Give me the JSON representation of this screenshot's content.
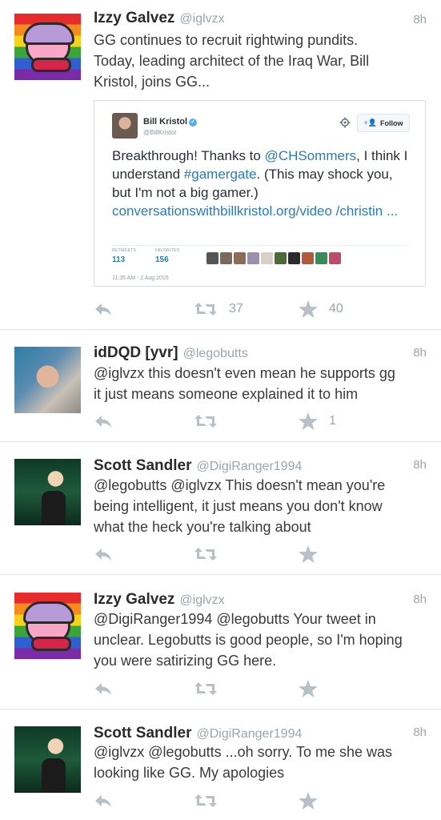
{
  "tweets": [
    {
      "name": "Izzy Galvez",
      "handle": "@iglvzx",
      "time": "8h",
      "lines": [
        "GG continues to recruit rightwing pundits.",
        "Today, leading architect of the Iraq War, Bill",
        "Kristol, joins GG..."
      ],
      "retweets": "37",
      "favorites": "40",
      "avatar": "rainbow-kirby"
    },
    {
      "name": "idDQD [yvr]",
      "handle": "@legobutts",
      "time": "8h",
      "lines": [
        "@iglvzx this doesn't even mean he supports gg",
        "it just means someone explained it to him"
      ],
      "retweets": "",
      "favorites": "1",
      "avatar": "photo"
    },
    {
      "name": "Scott Sandler",
      "handle": "@DigiRanger1994",
      "time": "8h",
      "lines": [
        "@legobutts @iglvzx This doesn't mean you're",
        "being intelligent, it just means you don't know",
        "what the heck you're talking about"
      ],
      "retweets": "",
      "favorites": "",
      "avatar": "cartoon"
    },
    {
      "name": "Izzy Galvez",
      "handle": "@iglvzx",
      "time": "8h",
      "lines": [
        "@DigiRanger1994 @legobutts Your tweet in",
        "unclear. Legobutts is good people, so I'm hoping",
        "you were satirizing GG here."
      ],
      "retweets": "",
      "favorites": "",
      "avatar": "rainbow-kirby"
    },
    {
      "name": "Scott Sandler",
      "handle": "@DigiRanger1994",
      "time": "8h",
      "lines": [
        "@iglvzx @legobutts ...oh sorry. To me she was",
        "looking like GG. My apologies"
      ],
      "retweets": "",
      "favorites": "",
      "avatar": "cartoon"
    }
  ],
  "embedded": {
    "name": "Bill Kristol",
    "handle": "@BillKristol",
    "follow_label": "Follow",
    "text_parts": [
      {
        "t": "Breakthrough! Thanks to ",
        "hl": false
      },
      {
        "t": "@CHSommers",
        "hl": true
      },
      {
        "t": ", I think I understand ",
        "hl": false
      },
      {
        "t": "#gamergate",
        "hl": true
      },
      {
        "t": ". (This may shock you, but I'm not a big gamer.) ",
        "hl": false
      },
      {
        "t": "conversationswithbillkristol.org/video /christin ...",
        "hl": true
      }
    ],
    "retweets_label": "RETWEETS",
    "retweets": "113",
    "favorites_label": "FAVORITES",
    "favorites": "156",
    "date": "11:35 AM - 2 Aug 2015",
    "fav_avatar_colors": [
      "#555555",
      "#7a6a5a",
      "#8c6b5b",
      "#9a8fb0",
      "#d8d0c8",
      "#4a6a3a",
      "#2a2a2a",
      "#b05a3a",
      "#3a8a5a",
      "#c04a6a"
    ]
  },
  "colors": {
    "link": "#2b7bb9",
    "action_icon": "#b7c0c7",
    "meta_text": "#9aa5ae"
  }
}
